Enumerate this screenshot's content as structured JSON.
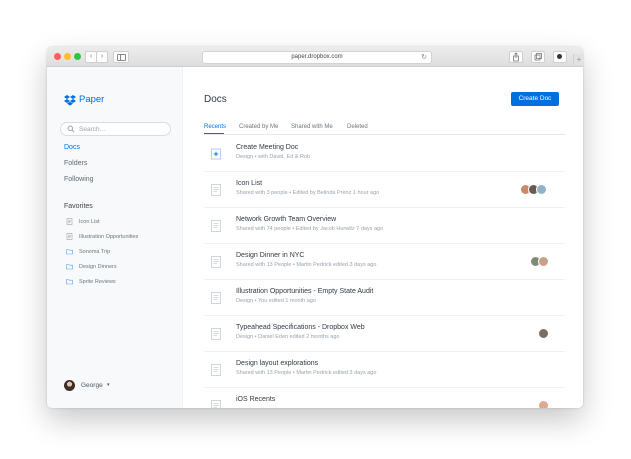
{
  "browser": {
    "url": "paper.dropbox.com",
    "back_glyph": "‹",
    "forward_glyph": "›",
    "reload_glyph": "↻",
    "new_tab_glyph": "+",
    "icons": [
      "back-icon",
      "forward-icon",
      "sidebar-toggle-icon",
      "reload-icon",
      "share-icon",
      "tabs-icon",
      "extension-icon"
    ]
  },
  "brand": {
    "name": "Paper",
    "logo_icon": "dropbox-logo-icon",
    "color": "#0070e0"
  },
  "sidebar": {
    "search_placeholder": "Search...",
    "nav": [
      {
        "label": "Docs",
        "active": true
      },
      {
        "label": "Folders",
        "active": false
      },
      {
        "label": "Following",
        "active": false
      }
    ],
    "favorites_header": "Favorites",
    "favorites": [
      {
        "label": "Icon List",
        "icon": "doc-icon"
      },
      {
        "label": "Illustration Opportunities",
        "icon": "doc-icon"
      },
      {
        "label": "Sonoma Trip",
        "icon": "folder-icon"
      },
      {
        "label": "Design Dinners",
        "icon": "folder-icon"
      },
      {
        "label": "Sprite Reviews",
        "icon": "folder-icon"
      }
    ],
    "user": {
      "name": "George",
      "caret": "▾"
    }
  },
  "main": {
    "title": "Docs",
    "create_button": "Create Doc",
    "tabs": [
      {
        "label": "Recents",
        "active": true
      },
      {
        "label": "Created by Me",
        "active": false
      },
      {
        "label": "Shared with Me",
        "active": false
      },
      {
        "label": "Deleted",
        "active": false
      }
    ],
    "docs": [
      {
        "title": "Create Meeting Doc",
        "meta": "Design • with David, Ed & Rob",
        "icon": "add-doc-icon",
        "avatars": []
      },
      {
        "title": "Icon List",
        "meta": "Shared with 3 people • Edited by Belinda Prenz 1 hour ago",
        "icon": "doc-icon",
        "avatars": [
          "#c98a6a",
          "#6a5a50",
          "#8fb3c9"
        ]
      },
      {
        "title": "Network Growth Team Overview",
        "meta": "Shared with 74 people • Edited by Jacob Hurwitz 7 days ago",
        "icon": "doc-icon",
        "avatars": []
      },
      {
        "title": "Design Dinner in NYC",
        "meta": "Shared with 13 People • Martin Pedrick edited 3 days ago",
        "icon": "doc-icon",
        "avatars": [
          "#7d8a7a",
          "#c9a08a"
        ]
      },
      {
        "title": "Illustration Opportunities - Empty State Audit",
        "meta": "Design • You edited 1 month ago",
        "icon": "doc-icon",
        "avatars": []
      },
      {
        "title": "Typeahead Specifications - Dropbox Web",
        "meta": "Design • Daniel Eden edited 2 months ago",
        "icon": "doc-icon",
        "avatars": [
          "#7a6e66"
        ]
      },
      {
        "title": "Design layout explorations",
        "meta": "Shared with 13 People • Martin Pedrick edited 3 days ago",
        "icon": "doc-icon",
        "avatars": []
      },
      {
        "title": "iOS Recents",
        "meta": "",
        "icon": "doc-icon",
        "avatars": [
          "#e0a890"
        ]
      }
    ]
  }
}
